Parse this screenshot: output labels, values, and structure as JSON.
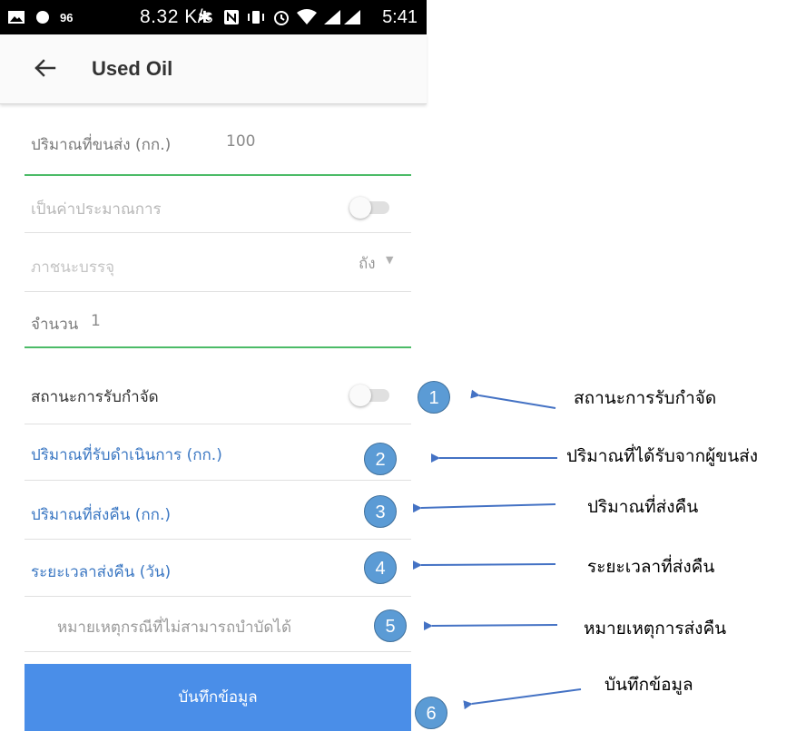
{
  "status_bar": {
    "notif_count": "96",
    "network_speed": "8.32 K/s",
    "time": "5:41"
  },
  "app_bar": {
    "title": "Used Oil"
  },
  "form": {
    "transported_amount": {
      "label": "ปริมาณที่ขนส่ง (กก.)",
      "value": "100"
    },
    "estimated": {
      "label": "เป็นค่าประมาณการ",
      "on": false
    },
    "container": {
      "label": "ภาชนะบรรจุ",
      "value": "ถัง"
    },
    "quantity": {
      "label": "จำนวน",
      "value": "1"
    },
    "disposal_status": {
      "label": "สถานะการรับกำจัด",
      "on": false
    },
    "received_amount": {
      "label": "ปริมาณที่รับดำเนินการ (กก.)"
    },
    "returned_amount": {
      "label": "ปริมาณที่ส่งคืน (กก.)"
    },
    "return_period": {
      "label": "ระยะเวลาส่งคืน (วัน)"
    },
    "reason": {
      "placeholder": "หมายเหตุกรณีที่ไม่สามารถบำบัดได้"
    },
    "save_label": "บันทึกข้อมูล"
  },
  "annotations": [
    {
      "number": "1",
      "text": "สถานะการรับกำจัด"
    },
    {
      "number": "2",
      "text": "ปริมาณที่ได้รับจากผู้ขนส่ง"
    },
    {
      "number": "3",
      "text": "ปริมาณที่ส่งคืน"
    },
    {
      "number": "4",
      "text": "ระยะเวลาที่ส่งคืน"
    },
    {
      "number": "5",
      "text": "หมายเหตุการส่งคืน"
    },
    {
      "number": "6",
      "text": "บันทึกข้อมูล"
    }
  ],
  "colors": {
    "accent_blue": "#4a8ee8",
    "link_blue": "#3c78c3",
    "underline_green": "#4cbb67",
    "badge_blue": "#5b9bd5"
  }
}
